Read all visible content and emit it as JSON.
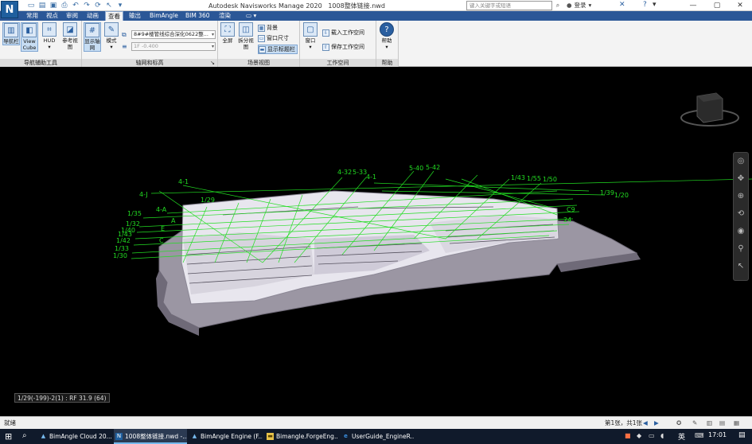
{
  "app": {
    "window_title": "Autodesk Navisworks Manage 2020",
    "file_name": "1008整体链接.nwd",
    "search_placeholder": "键入关键字或短语",
    "user_label": "登录",
    "logo_letter": "N"
  },
  "ribbon_tabs": [
    "常用",
    "视点",
    "审阅",
    "动画",
    "查看",
    "输出",
    "BimAngle",
    "BIM 360",
    "渲染"
  ],
  "active_tab": "查看",
  "panels": {
    "nav_aids": {
      "title": "导航辅助工具",
      "nav_bar": "导航栏",
      "view_cube": "View Cube",
      "hud": "HUD",
      "reference_view": "参考视图"
    },
    "grids": {
      "title": "轴网和标高",
      "show_grid": "显示轴网",
      "mode": "模式",
      "model_combo": "8#9#楼管线综合深化0622整...",
      "level_combo": "1F -0.400"
    },
    "scene_view": {
      "title": "场景视图",
      "fullscreen": "全屏",
      "split_view": "拆分视图",
      "background": "背景",
      "window_size": "窗口尺寸",
      "show_titlebar": "显示标题栏"
    },
    "workspace": {
      "title": "工作空间",
      "window": "窗口",
      "load_workspace": "载入工作空间",
      "save_workspace": "保存工作空间"
    },
    "help": {
      "title": "帮助",
      "help": "帮助"
    }
  },
  "viewport": {
    "grid_color": "#22dd22",
    "grid_labels": [
      "4-J",
      "4-1",
      "4-32",
      "5-33",
      "5-40",
      "5-42",
      "4-1",
      "1/35",
      "4-A",
      "1/32",
      "1/40",
      "1/43",
      "1/42",
      "1/33",
      "1/30",
      "1/29",
      "1/43",
      "1/55",
      "1/50",
      "C",
      "E",
      "A",
      "1/39",
      "1/20",
      "24",
      "C9"
    ],
    "coordinate_readout": "1/29(-199)-2(1) : RF 31.9 (64)"
  },
  "status": {
    "left": "就绪",
    "page": "第1张，共1张"
  },
  "taskbar": {
    "items": [
      "BimAngle Cloud 20...",
      "1008整体链接.nwd -...",
      "BimAngle Engine (F...",
      "Bimangle.ForgeEng...",
      "UserGuide_EngineR..."
    ],
    "ime": "英",
    "time": "17:01"
  }
}
